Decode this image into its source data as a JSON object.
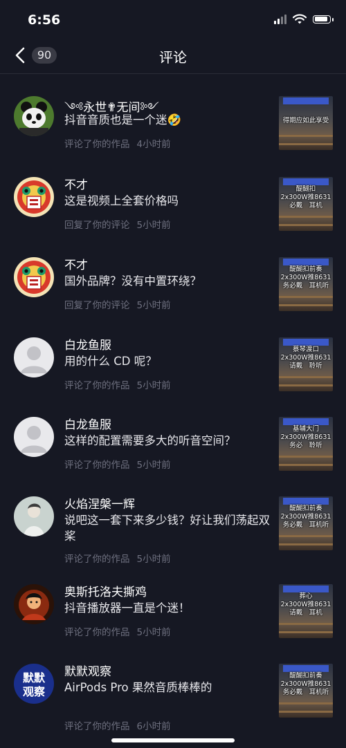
{
  "status": {
    "time": "6:56",
    "battery_level": 0.9
  },
  "nav": {
    "count": "90",
    "title": "评论"
  },
  "items": [
    {
      "avatar": "panda",
      "name": "༺永世✟无间༻",
      "comment": "抖音音质也是一个迷🤣",
      "action": "评论了你的作品",
      "time": "4小时前",
      "thumb_lines": [
        "得期应如此享受"
      ]
    },
    {
      "avatar": "lion",
      "name": "不才",
      "comment": "这是视频上全套价格吗",
      "action": "回复了你的评论",
      "time": "5小时前",
      "thumb_lines": [
        "醍醐扣",
        "2x300W推8631",
        "必戴　耳机"
      ]
    },
    {
      "avatar": "lion",
      "name": "不才",
      "comment": "国外品牌？没有中置环绕？",
      "action": "回复了你的评论",
      "time": "5小时前",
      "thumb_lines": [
        "醍醐扣前奏",
        "2x300W推8631",
        "务必戴　耳机听"
      ]
    },
    {
      "avatar": "default",
      "name": "白龙鱼服",
      "comment": "用的什么 CD 呢？",
      "action": "评论了你的作品",
      "time": "5小时前",
      "thumb_lines": [
        "蔡琴渡口",
        "2x300W推8631",
        "请戴　聆听"
      ]
    },
    {
      "avatar": "default",
      "name": "白龙鱼服",
      "comment": "这样的配置需要多大的听音空间？",
      "action": "评论了你的作品",
      "time": "5小时前",
      "thumb_lines": [
        "基辅大门",
        "2x300W推8631",
        "务必　聆听"
      ]
    },
    {
      "avatar": "figure",
      "name": "火焰涅槃一辉",
      "comment": "说吧这一套下来多少钱？好让我们荡起双桨",
      "action": "评论了你的作品",
      "time": "5小时前",
      "thumb_lines": [
        "醍醐扣前奏",
        "2x300W推8631",
        "务必戴　耳机听"
      ]
    },
    {
      "avatar": "warrior",
      "name": "奥斯托洛夫撕鸡",
      "comment": "抖音播放器一直是个迷！",
      "action": "评论了你的作品",
      "time": "5小时前",
      "thumb_lines": [
        "葬心",
        "2x300W推8631",
        "请戴　耳机"
      ]
    },
    {
      "avatar": "text",
      "avatar_text": [
        "默默",
        "观察"
      ],
      "name": "默默观察",
      "comment": "AirPods Pro 果然音质棒棒的",
      "action": "评论了你的作品",
      "time": "6小时前",
      "thumb_lines": [
        "醍醐扣前奏",
        "2x300W推8631",
        "务必戴　耳机听"
      ]
    }
  ],
  "colors": {
    "background": "#161823",
    "text_primary": "#ffffff",
    "text_secondary": "#6f7180"
  }
}
